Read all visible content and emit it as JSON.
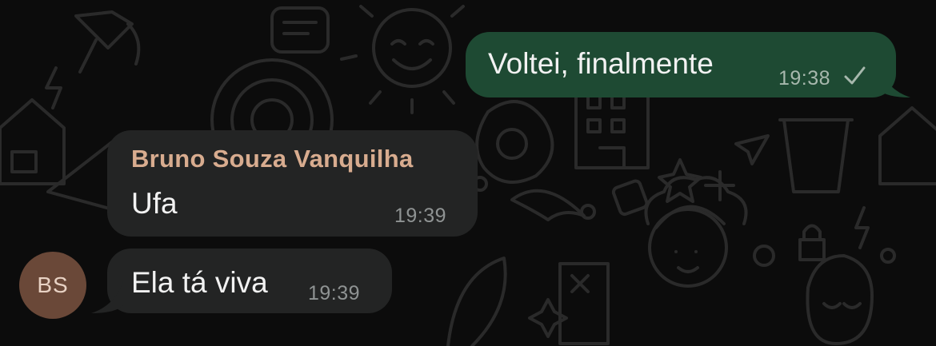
{
  "chat": {
    "messages": [
      {
        "direction": "outgoing",
        "text": "Voltei, finalmente",
        "time": "19:38",
        "status_icon": "single-check-icon"
      },
      {
        "direction": "incoming",
        "sender": "Bruno Souza Vanquilha",
        "text": "Ufa",
        "time": "19:39"
      },
      {
        "direction": "incoming",
        "text": "Ela tá viva",
        "time": "19:39"
      }
    ],
    "avatar": {
      "initials": "BS",
      "color": "#6a4838"
    }
  },
  "colors": {
    "background": "#0c0c0c",
    "outgoing_bubble": "#1e4a33",
    "incoming_bubble": "#232424",
    "sender_name": "#d8ac8f",
    "message_text": "#f2f2f2"
  },
  "icons": {
    "wallpaper": "doodle-pattern"
  }
}
